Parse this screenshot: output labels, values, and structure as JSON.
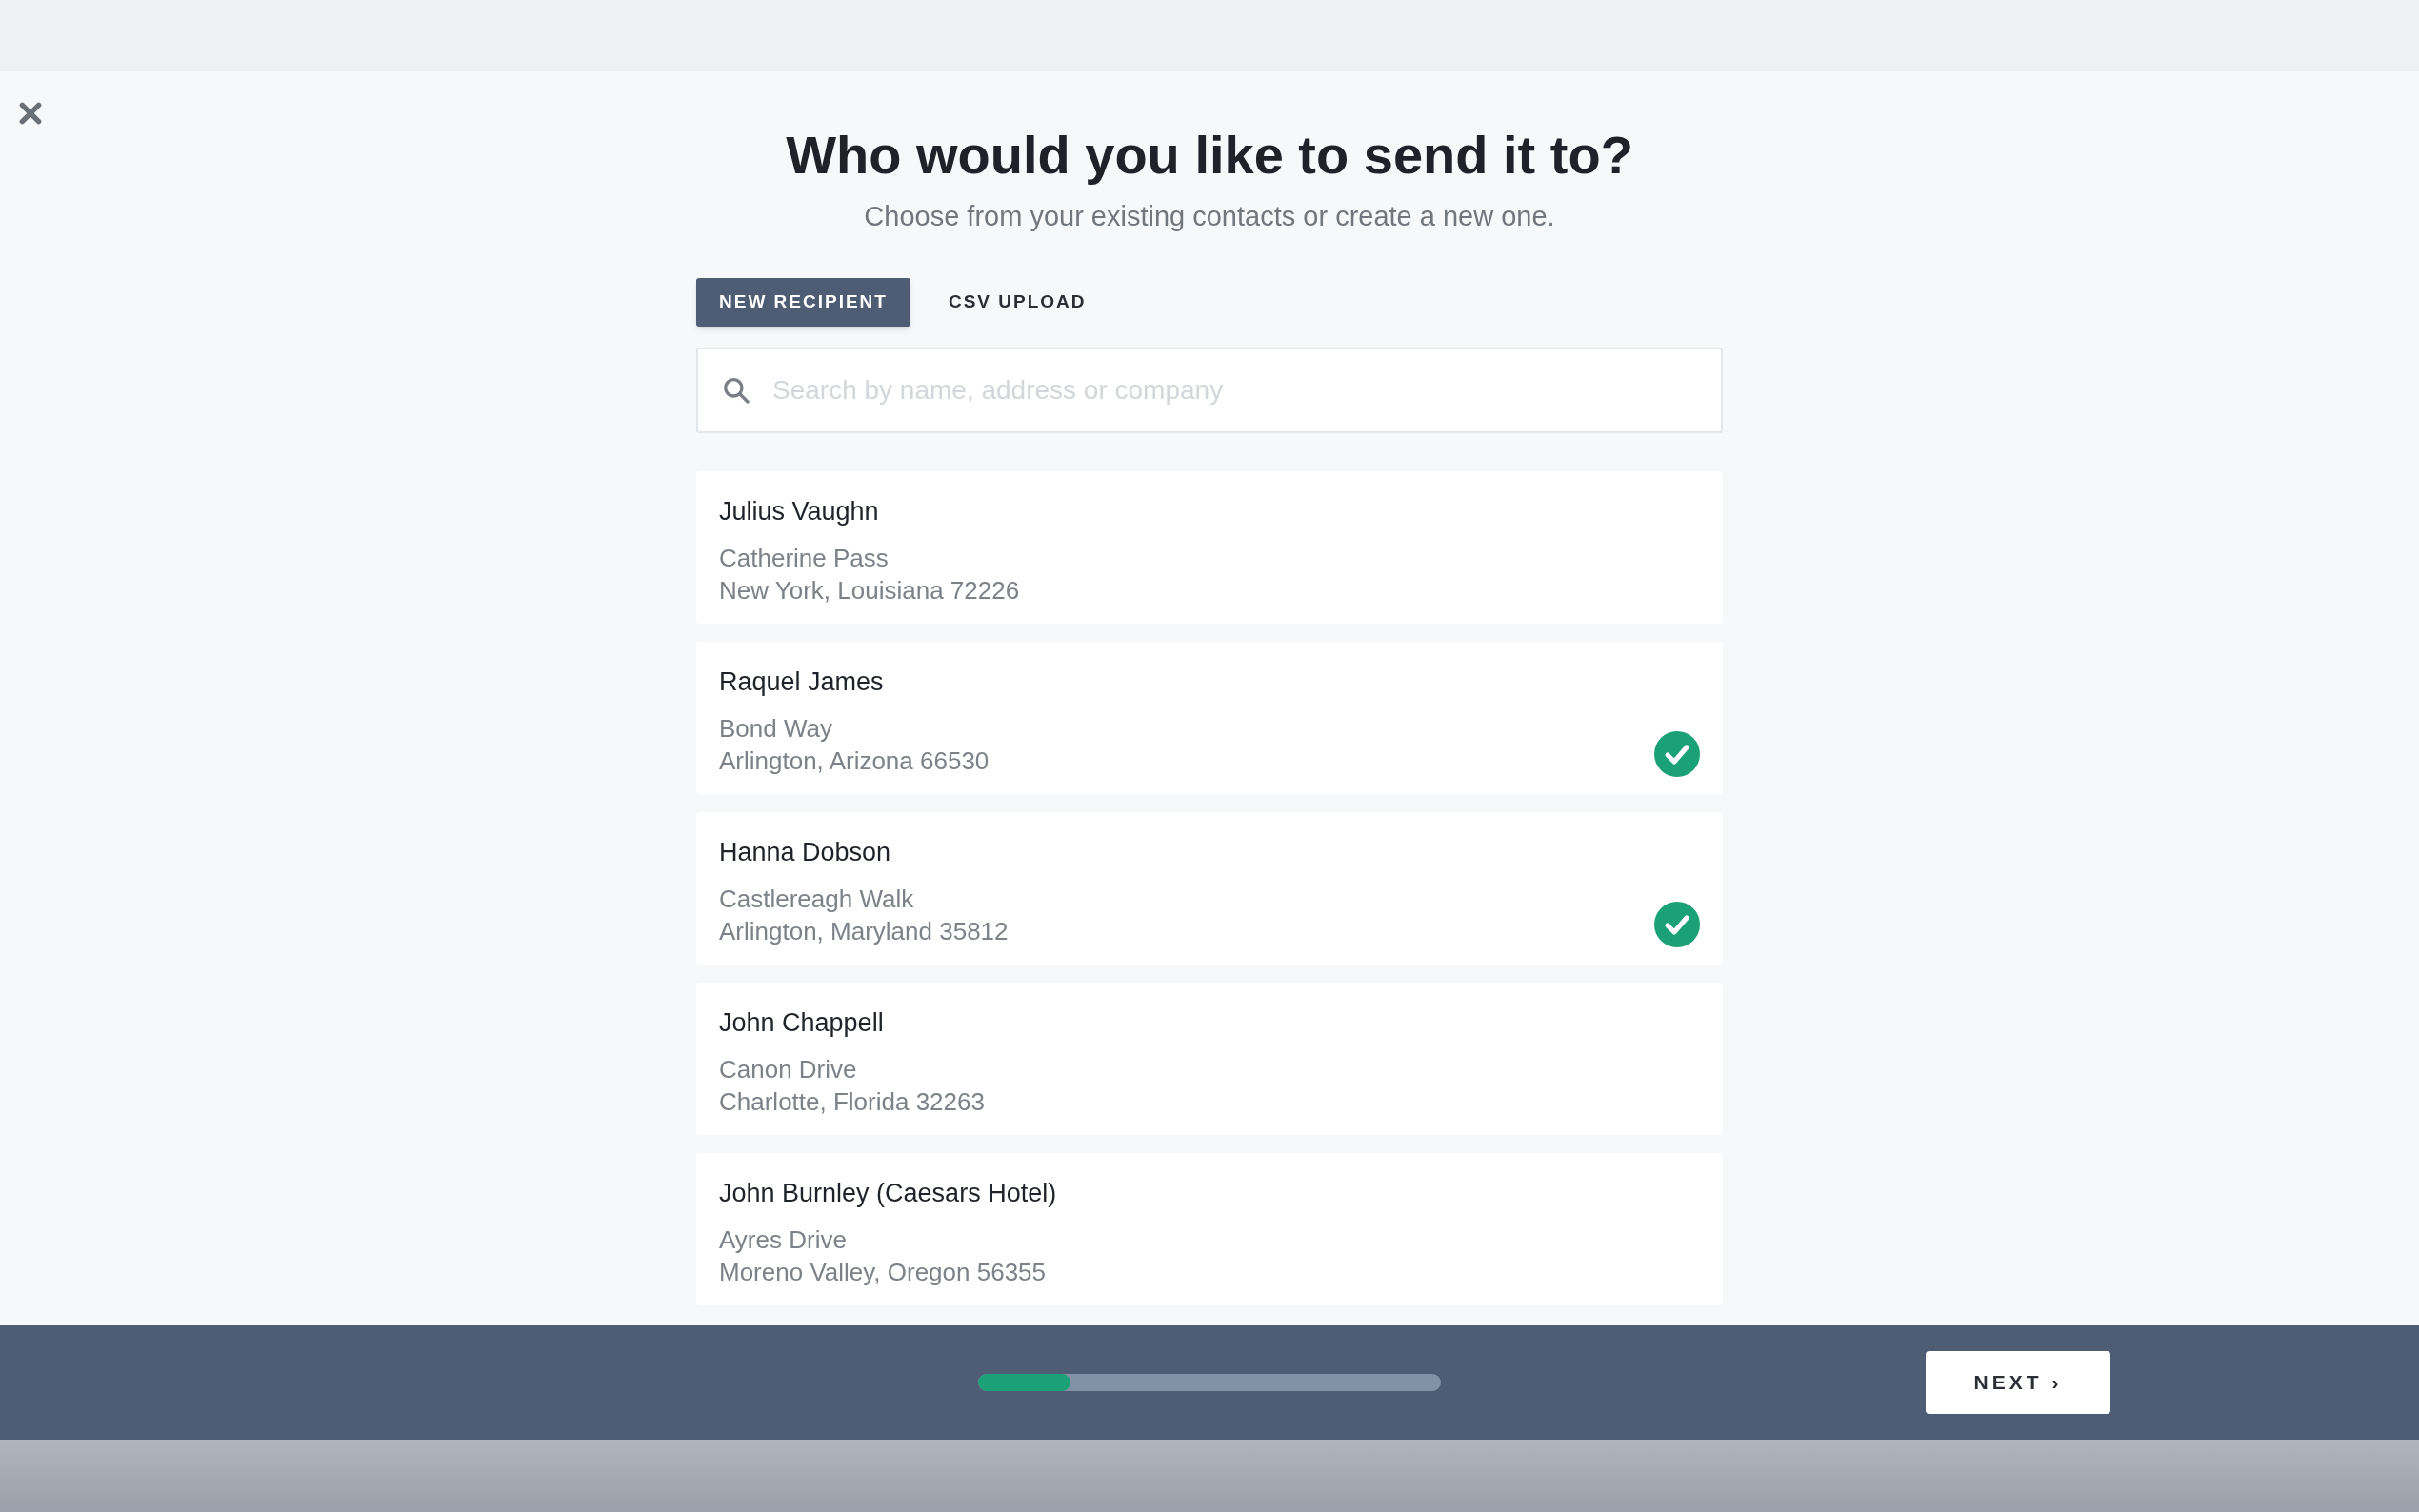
{
  "title": "Who would you like to send it to?",
  "subtitle": "Choose from your existing contacts or create a new one.",
  "tabs": [
    {
      "label": "NEW RECIPIENT",
      "selected": true
    },
    {
      "label": "CSV UPLOAD",
      "selected": false
    }
  ],
  "search": {
    "placeholder": "Search by name, address or company"
  },
  "contacts": [
    {
      "name": "Julius Vaughn",
      "street": "Catherine Pass",
      "city": "New York, Louisiana 72226",
      "selected": false
    },
    {
      "name": "Raquel James",
      "street": "Bond Way",
      "city": "Arlington, Arizona 66530",
      "selected": true
    },
    {
      "name": "Hanna Dobson",
      "street": "Castlereagh Walk",
      "city": "Arlington, Maryland 35812",
      "selected": true
    },
    {
      "name": "John Chappell",
      "street": "Canon Drive",
      "city": "Charlotte, Florida 32263",
      "selected": false
    },
    {
      "name": "John Burnley (Caesars Hotel)",
      "street": "Ayres Drive",
      "city": "Moreno Valley, Oregon 56355",
      "selected": false
    }
  ],
  "footer": {
    "progress": {
      "level": 0.2
    },
    "next_button": "NEXT ›"
  }
}
